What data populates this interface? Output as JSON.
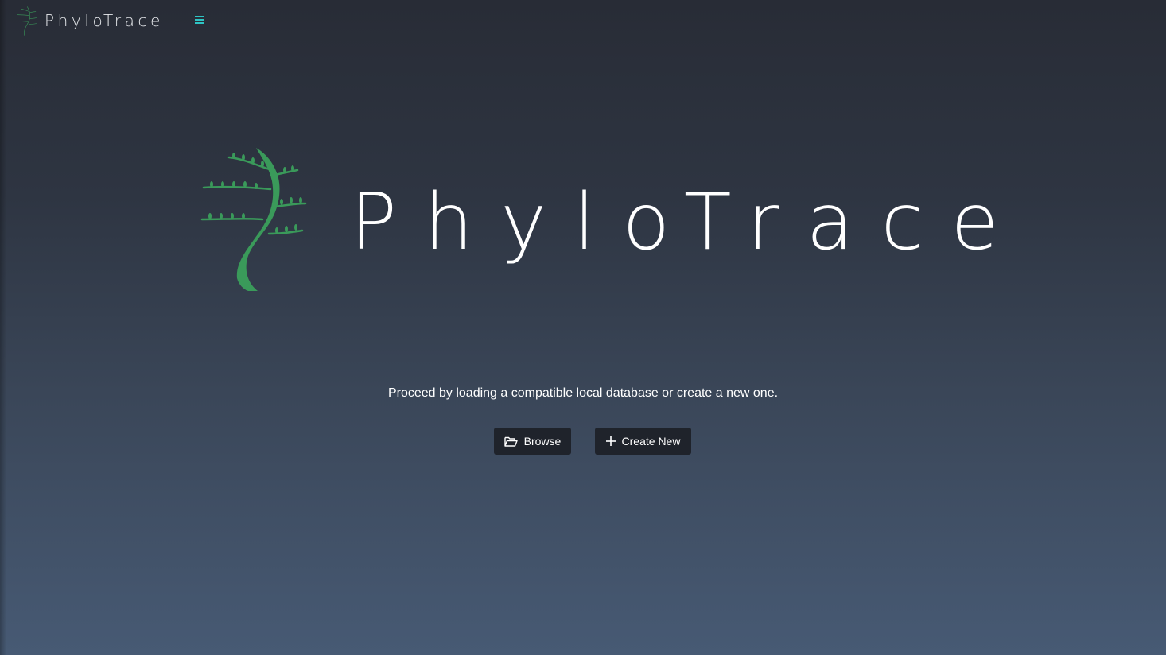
{
  "app": {
    "name": "PhyloTrace"
  },
  "header": {
    "brand_name": "PhyloTrace",
    "menu_icon": "hamburger-menu-icon",
    "logo_icon": "tree-logo-icon"
  },
  "hero": {
    "title": "PhyloTrace",
    "logo_icon": "tree-logo-icon"
  },
  "main": {
    "message": "Proceed by loading a compatible local database or create a new one.",
    "browse_button": {
      "label": "Browse",
      "icon": "folder-open-icon"
    },
    "create_button": {
      "label": "Create New",
      "icon": "plus-icon"
    }
  },
  "colors": {
    "accent": "#2ec4c4",
    "tree_green": "#3a9a5a",
    "button_bg": "#1f232b",
    "background_top": "#282c36",
    "background_bottom": "#475a74"
  }
}
